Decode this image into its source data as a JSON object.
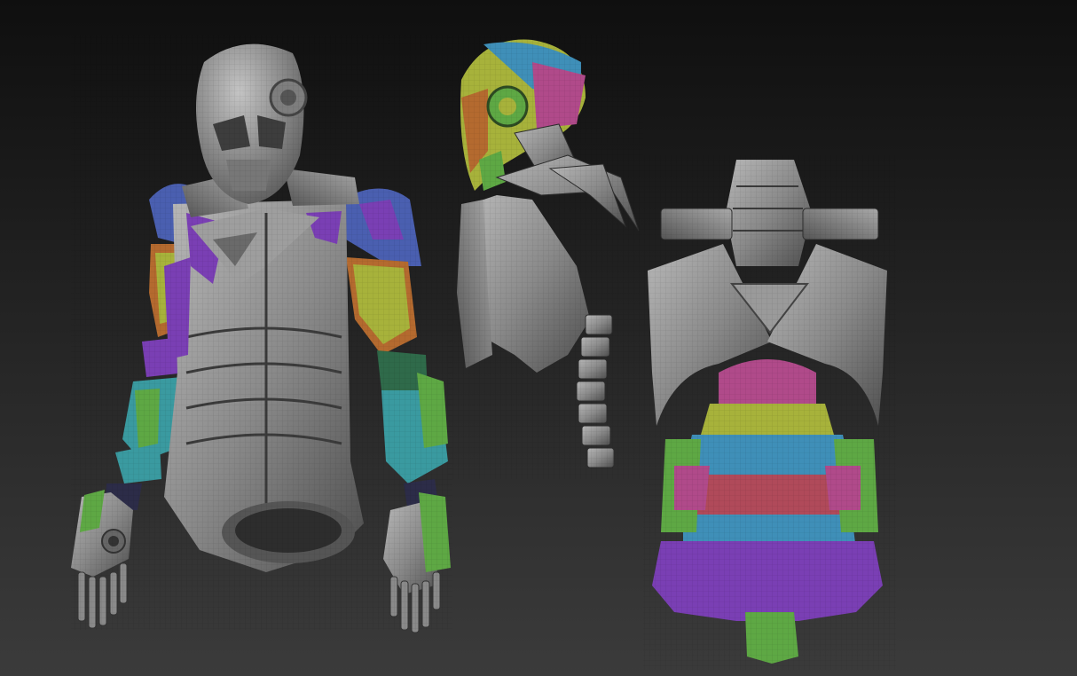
{
  "scene": {
    "background_top": "#0f0f0f",
    "background_bottom": "#3b3b3b",
    "views": [
      "front-view",
      "side-view",
      "back-view"
    ]
  },
  "palette": {
    "armor_gray": "#8e8e8e",
    "armor_gray_dark": "#5b5b5b",
    "armor_gray_light": "#b5b5b5",
    "polygroup_blue": "#4a5fb0",
    "polygroup_purple": "#7a3fb4",
    "polygroup_yellow": "#a7b23b",
    "polygroup_orange": "#b46a2f",
    "polygroup_teal": "#3a9aa0",
    "polygroup_green": "#5ea844",
    "polygroup_magenta": "#b04a8a",
    "polygroup_cyan": "#3f8fb8",
    "polygroup_red": "#b04a5a",
    "wire": "#222222"
  }
}
